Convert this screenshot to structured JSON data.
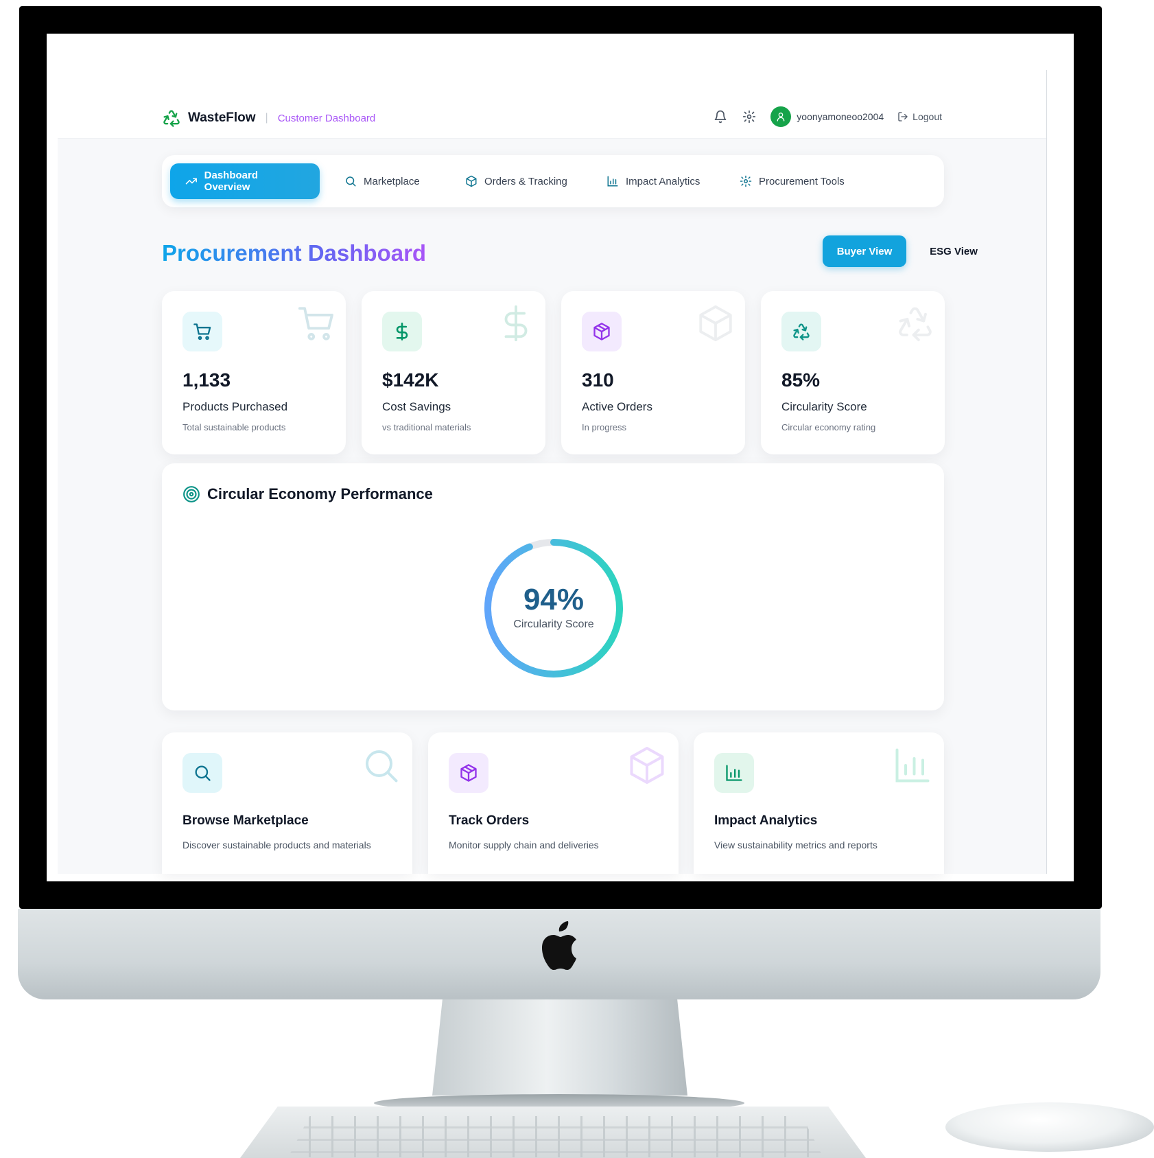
{
  "brand": {
    "name": "WasteFlow",
    "separator": "|",
    "subtitle": "Customer Dashboard"
  },
  "header": {
    "username": "yoonyamoneoo2004",
    "logout_label": "Logout"
  },
  "nav": {
    "items": [
      {
        "label": "Dashboard Overview",
        "icon": "trending-up-icon",
        "active": true
      },
      {
        "label": "Marketplace",
        "icon": "search-icon",
        "active": false
      },
      {
        "label": "Orders & Tracking",
        "icon": "package-icon",
        "active": false
      },
      {
        "label": "Impact Analytics",
        "icon": "bar-chart-icon",
        "active": false
      },
      {
        "label": "Procurement Tools",
        "icon": "gear-icon",
        "active": false
      }
    ]
  },
  "page": {
    "title": "Procurement Dashboard",
    "view_buttons": [
      {
        "label": "Buyer View",
        "active": true
      },
      {
        "label": "ESG View",
        "active": false
      }
    ]
  },
  "stats": [
    {
      "value": "1,133",
      "label": "Products Purchased",
      "sub": "Total sustainable products",
      "icon": "cart-icon",
      "color": "#0e7490",
      "bg": "#e6f8fb"
    },
    {
      "value": "$142K",
      "label": "Cost Savings",
      "sub": "vs traditional materials",
      "icon": "dollar-icon",
      "color": "#059669",
      "bg": "#e3f7ee"
    },
    {
      "value": "310",
      "label": "Active Orders",
      "sub": "In progress",
      "icon": "package-icon",
      "color": "#9333ea",
      "bg": "#f3eafe"
    },
    {
      "value": "85%",
      "label": "Circularity Score",
      "sub": "Circular economy rating",
      "icon": "recycle-icon",
      "color": "#0d9488",
      "bg": "#e3f6f3"
    }
  ],
  "performance": {
    "title": "Circular Economy Performance",
    "score_text": "94%",
    "score_fraction": 0.94,
    "score_label": "Circularity Score"
  },
  "actions": [
    {
      "title": "Browse Marketplace",
      "desc": "Discover sustainable products and materials",
      "icon": "search-icon",
      "color": "#0e7490",
      "bg": "#e0f6fa"
    },
    {
      "title": "Track Orders",
      "desc": "Monitor supply chain and deliveries",
      "icon": "package-icon",
      "color": "#9333ea",
      "bg": "#f3eafe"
    },
    {
      "title": "Impact Analytics",
      "desc": "View sustainability metrics and reports",
      "icon": "bar-chart-icon",
      "color": "#059669",
      "bg": "#e2f6ec"
    }
  ],
  "colors": {
    "accent": "#0ea5e9",
    "title_gradient": [
      "#0ea5e9",
      "#6366f1",
      "#a855f7"
    ],
    "gauge_gradient": [
      "#60a5fa",
      "#2dd4bf"
    ]
  }
}
